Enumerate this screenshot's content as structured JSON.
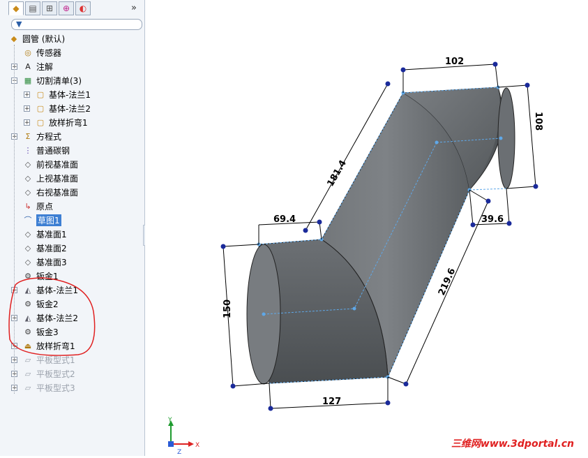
{
  "tabs": [
    {
      "icon": "part-icon"
    },
    {
      "icon": "property-manager-icon"
    },
    {
      "icon": "configuration-manager-icon"
    },
    {
      "icon": "dim-xpert-icon"
    },
    {
      "icon": "display-manager-icon"
    }
  ],
  "tabs_more": "»",
  "tree": {
    "root": "圆管 (默认)",
    "items": [
      {
        "label": "传感器"
      },
      {
        "label": "注解"
      },
      {
        "label": "切割清单(3)"
      },
      {
        "label": "基体-法兰1"
      },
      {
        "label": "基体-法兰2"
      },
      {
        "label": "放样折弯1"
      },
      {
        "label": "方程式"
      },
      {
        "label": "普通碳钢"
      },
      {
        "label": "前视基准面"
      },
      {
        "label": "上视基准面"
      },
      {
        "label": "右视基准面"
      },
      {
        "label": "原点"
      },
      {
        "label": "草图1"
      },
      {
        "label": "基准面1"
      },
      {
        "label": "基准面2"
      },
      {
        "label": "基准面3"
      },
      {
        "label": "钣金1"
      },
      {
        "label": "基体-法兰1"
      },
      {
        "label": "钣金2"
      },
      {
        "label": "基体-法兰2"
      },
      {
        "label": "钣金3"
      },
      {
        "label": "放样折弯1"
      },
      {
        "label": "平板型式1"
      },
      {
        "label": "平板型式2"
      },
      {
        "label": "平板型式3"
      }
    ]
  },
  "dimensions": {
    "d102": "102",
    "d108": "108",
    "d181": "181.4",
    "d69": "69.4",
    "d39": "39.6",
    "d150": "150",
    "d219": "219.6",
    "d127": "127"
  },
  "triad": {
    "x": "X",
    "y": "Y",
    "z": "Z"
  },
  "watermark": "三维网www.3dportal.cn",
  "colors": {
    "pipe": "#5f6366",
    "selection": "#3d7fd3",
    "annotation": "#e02020",
    "dim_point": "#1a2a9a"
  }
}
